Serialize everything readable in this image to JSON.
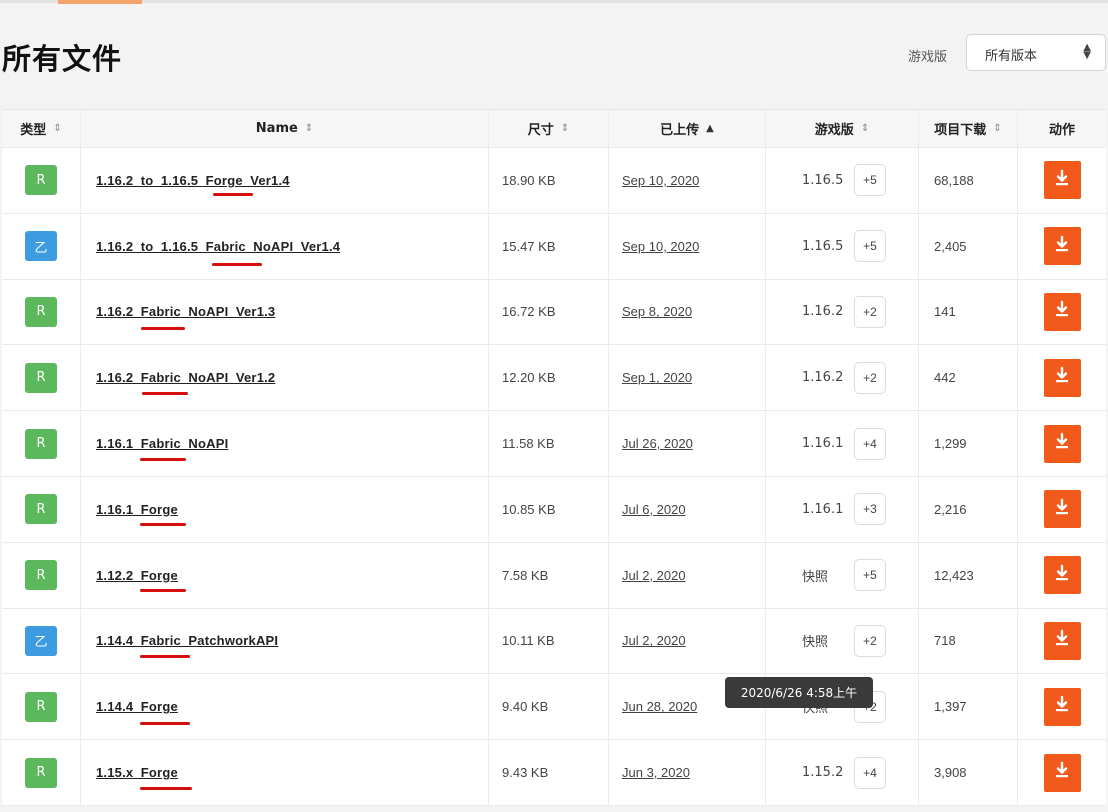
{
  "page": {
    "title": "所有文件"
  },
  "filter": {
    "label": "游戏版",
    "selected": "所有版本"
  },
  "table": {
    "columns": [
      {
        "key": "type",
        "label": "类型",
        "sort": "⇕"
      },
      {
        "key": "name",
        "label": "Name",
        "sort": "⇕"
      },
      {
        "key": "size",
        "label": "尺寸",
        "sort": "⇕"
      },
      {
        "key": "uploaded",
        "label": "已上传",
        "sort": "▲"
      },
      {
        "key": "game_version",
        "label": "游戏版",
        "sort": "⇕"
      },
      {
        "key": "downloads",
        "label": "项目下载",
        "sort": "⇕"
      },
      {
        "key": "actions",
        "label": "动作",
        "sort": ""
      }
    ],
    "rows": [
      {
        "type": "R",
        "name": "1.16.2_to_1.16.5_Forge_Ver1.4",
        "size": "18.90 KB",
        "uploaded": "Sep 10, 2020",
        "version": "1.16.5",
        "more": "+5",
        "downloads": "68,188"
      },
      {
        "type": "B",
        "name": "1.16.2_to_1.16.5_Fabric_NoAPI_Ver1.4",
        "size": "15.47 KB",
        "uploaded": "Sep 10, 2020",
        "version": "1.16.5",
        "more": "+5",
        "downloads": "2,405"
      },
      {
        "type": "R",
        "name": "1.16.2_Fabric_NoAPI_Ver1.3",
        "size": "16.72 KB",
        "uploaded": "Sep 8, 2020",
        "version": "1.16.2",
        "more": "+2",
        "downloads": "141"
      },
      {
        "type": "R",
        "name": "1.16.2_Fabric_NoAPI_Ver1.2",
        "size": "12.20 KB",
        "uploaded": "Sep 1, 2020",
        "version": "1.16.2",
        "more": "+2",
        "downloads": "442"
      },
      {
        "type": "R",
        "name": "1.16.1_Fabric_NoAPI",
        "size": "11.58 KB",
        "uploaded": "Jul 26, 2020",
        "version": "1.16.1",
        "more": "+4",
        "downloads": "1,299"
      },
      {
        "type": "R",
        "name": "1.16.1_Forge",
        "size": "10.85 KB",
        "uploaded": "Jul 6, 2020",
        "version": "1.16.1",
        "more": "+3",
        "downloads": "2,216"
      },
      {
        "type": "R",
        "name": "1.12.2_Forge",
        "size": "7.58 KB",
        "uploaded": "Jul 2, 2020",
        "version": "快照",
        "more": "+5",
        "downloads": "12,423"
      },
      {
        "type": "B",
        "name": "1.14.4_Fabric_PatchworkAPI",
        "size": "10.11 KB",
        "uploaded": "Jul 2, 2020",
        "version": "快照",
        "more": "+2",
        "downloads": "718"
      },
      {
        "type": "R",
        "name": "1.14.4_Forge",
        "size": "9.40 KB",
        "uploaded": "Jun 28, 2020",
        "version": "快照",
        "more": "+2",
        "downloads": "1,397"
      },
      {
        "type": "R",
        "name": "1.15.x_Forge",
        "size": "9.43 KB",
        "uploaded": "Jun 3, 2020",
        "version": "1.15.2",
        "more": "+4",
        "downloads": "3,908"
      }
    ]
  },
  "tooltip": {
    "text": "2020/6/26 4:58上午"
  },
  "type_labels": {
    "R": "R",
    "B": "乙"
  },
  "colors": {
    "release": "#5cb85c",
    "beta": "#3d9be0",
    "download": "#f25a1c",
    "annotation": "#d40e0e"
  },
  "icons": {
    "download": "download-icon",
    "sort": "sort-icon",
    "chevron": "chevron-updown-icon"
  }
}
